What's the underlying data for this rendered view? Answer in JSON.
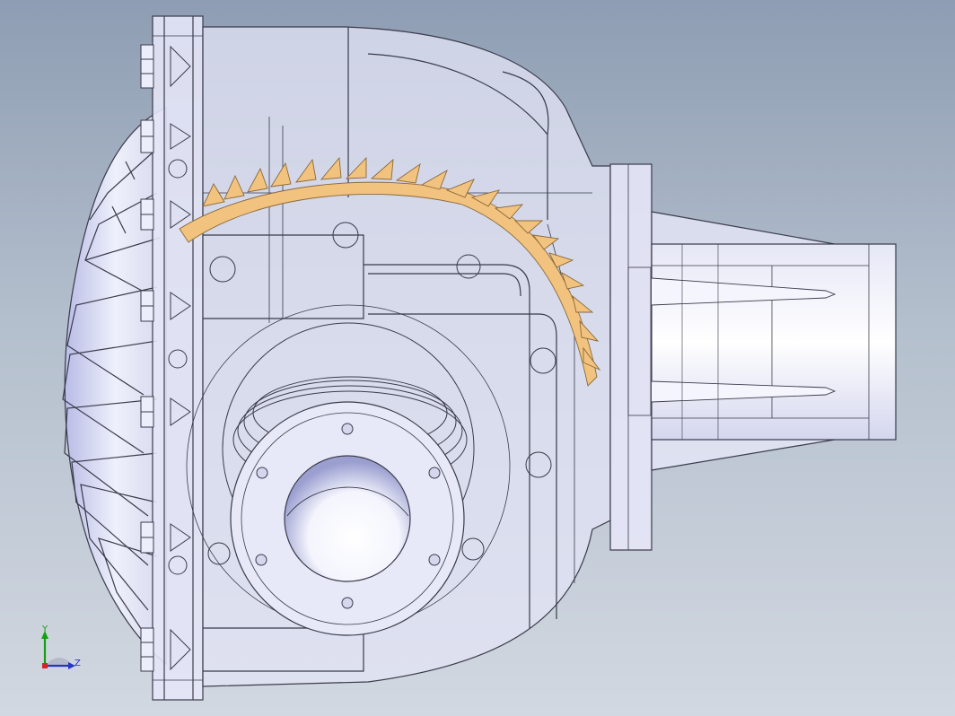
{
  "viewport": {
    "background_top": "#8e9db3",
    "background_bottom": "#d2d8e1"
  },
  "model": {
    "name": "differential-housing-assembly",
    "render_mode": "transparent-shaded-with-edges",
    "body_color": "#e3e4f6",
    "edge_color": "#3a3b4a",
    "ring_gear_color": "#f2c27f",
    "bolt_count_visible": 12
  },
  "triad": {
    "y_label": "Y",
    "z_label": "Z",
    "y_color": "#13a113",
    "z_color": "#2733c9",
    "x_color": "#d3242a"
  }
}
